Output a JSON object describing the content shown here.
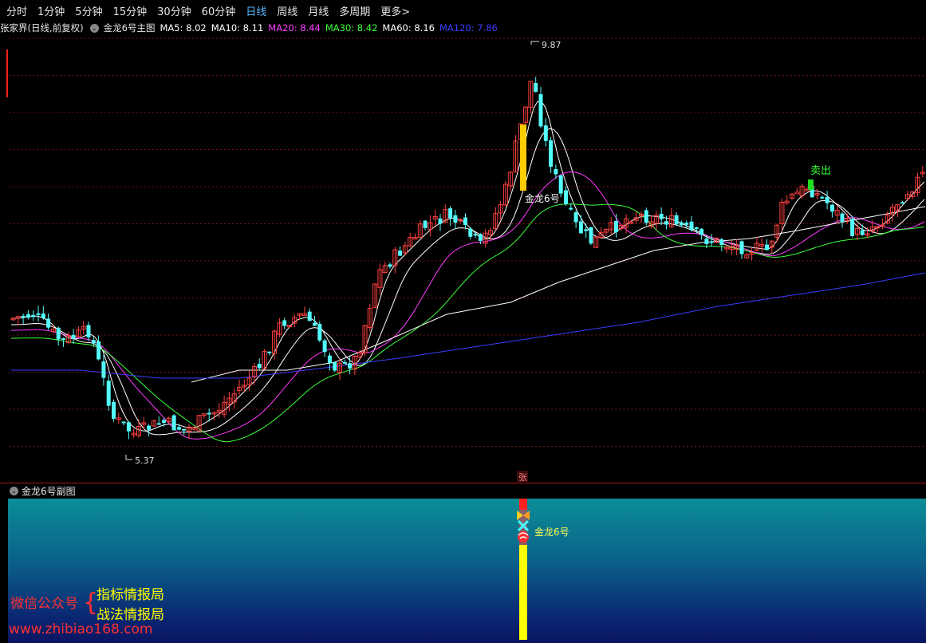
{
  "toolbar": {
    "tabs": [
      {
        "label": "分时"
      },
      {
        "label": "1分钟"
      },
      {
        "label": "5分钟"
      },
      {
        "label": "15分钟"
      },
      {
        "label": "30分钟"
      },
      {
        "label": "60分钟"
      },
      {
        "label": "日线"
      },
      {
        "label": "周线"
      },
      {
        "label": "月线"
      },
      {
        "label": "多周期"
      },
      {
        "label": "更多>"
      }
    ],
    "active_tab": "日线"
  },
  "info": {
    "stock": "张家界(日线,前复权)",
    "indicator": "金龙6号主图",
    "ma": [
      {
        "label": "MA5: 8.02",
        "color": "#ffffff"
      },
      {
        "label": "MA10: 8.11",
        "color": "#ffffff"
      },
      {
        "label": "MA20: 8.44",
        "color": "#ff3cff"
      },
      {
        "label": "MA30: 8.42",
        "color": "#3cff3c"
      },
      {
        "label": "MA60: 8.16",
        "color": "#ffffff"
      },
      {
        "label": "MA120: 7.86",
        "color": "#3c3cff"
      }
    ]
  },
  "chart": {
    "high_label": "9.87",
    "low_label": "5.37",
    "signal_label": "金龙6号",
    "sell_label": "卖出",
    "zhang_marker": "张"
  },
  "subchart": {
    "title": "金龙6号副图",
    "signal_label": "金龙6号"
  },
  "watermark": {
    "wechat": "微信公众号",
    "brace": "{",
    "line1": "指标情报局",
    "line2": "战法情报局",
    "url": "www.zhibiao168.com"
  },
  "colors": {
    "up": "#ff4040",
    "down": "#54fcfc",
    "signal_bar": "#ffcc00",
    "sub_bar": "#ffff00",
    "grid": "#7a1010"
  }
}
